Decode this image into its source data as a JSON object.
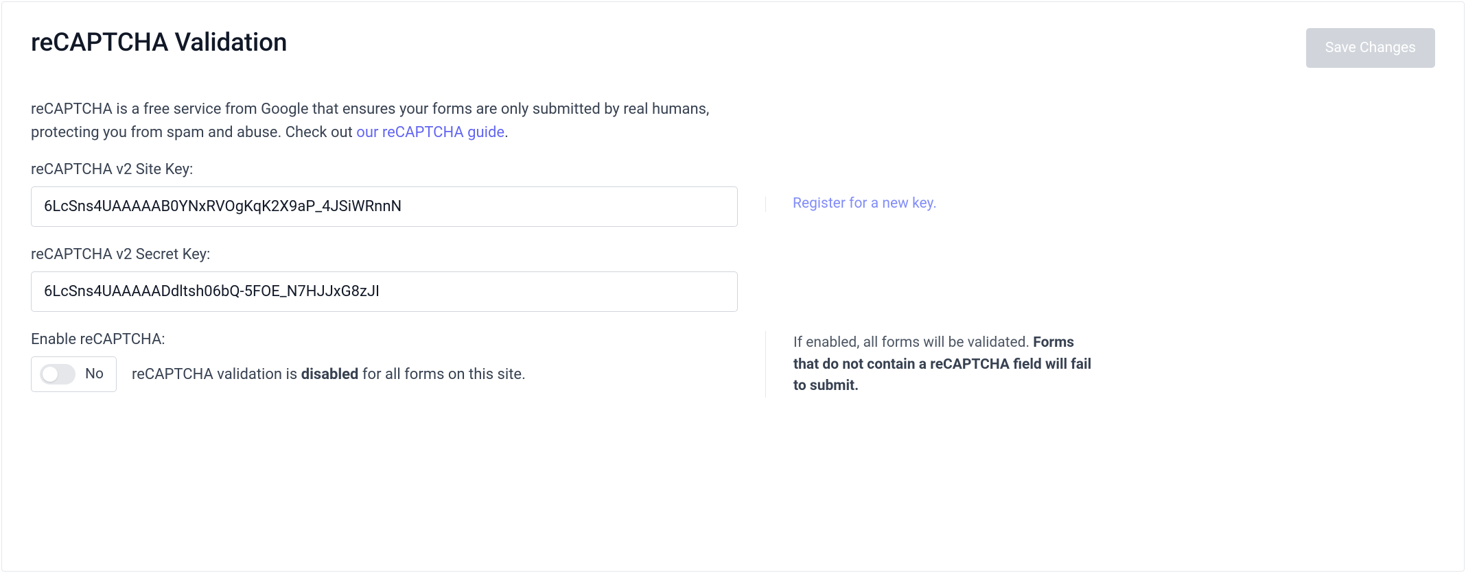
{
  "header": {
    "title": "reCAPTCHA Validation",
    "save_button": "Save Changes"
  },
  "description": {
    "text_before": "reCAPTCHA is a free service from Google that ensures your forms are only submitted by real humans, protecting you from spam and abuse. Check out ",
    "link_text": "our reCAPTCHA guide",
    "text_after": "."
  },
  "site_key": {
    "label": "reCAPTCHA v2 Site Key:",
    "value": "6LcSns4UAAAAAB0YNxRVOgKqK2X9aP_4JSiWRnnN",
    "register_link": "Register for a new key."
  },
  "secret_key": {
    "label": "reCAPTCHA v2 Secret Key:",
    "value": "6LcSns4UAAAAADdltsh06bQ-5FOE_N7HJJxG8zJI"
  },
  "enable": {
    "label": "Enable reCAPTCHA:",
    "toggle_state": "No",
    "status_prefix": "reCAPTCHA validation is ",
    "status_strong": "disabled",
    "status_suffix": " for all forms on this site.",
    "help_prefix": "If enabled, all forms will be validated. ",
    "help_strong": "Forms that do not contain a reCAPTCHA field will fail to submit."
  }
}
